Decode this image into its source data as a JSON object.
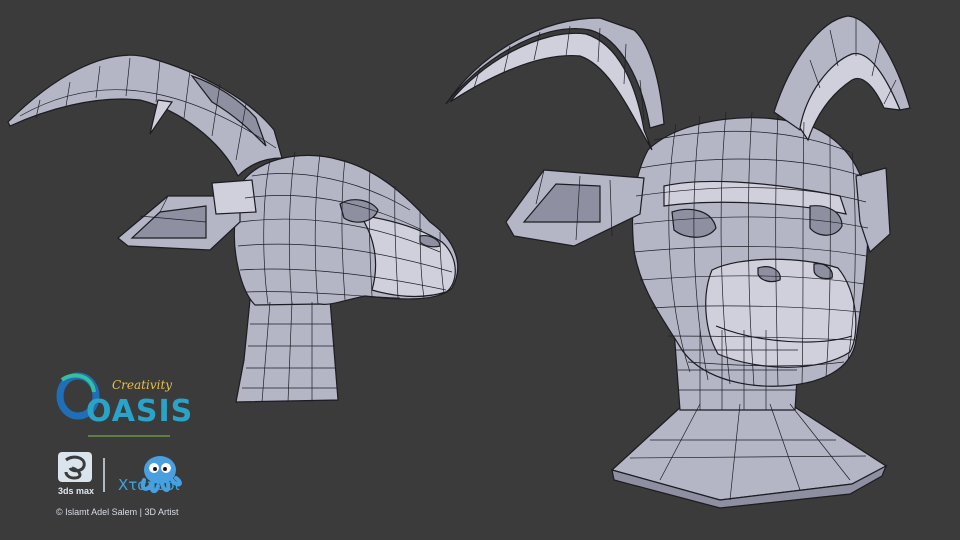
{
  "branding": {
    "tagline": "Creativity",
    "brand": "OASIS",
    "software": "3ds max",
    "studio": "Xταπόδι",
    "credit": "© Islamt Adel Salem | 3D Artist"
  },
  "colors": {
    "background": "#3b3b3b",
    "mesh": "#b4b6c6",
    "wire": "#1e1e26",
    "brand_blue": "#2aa3c8",
    "brand_gold": "#e6c04a"
  },
  "icons": [
    "3ds-max-logo-icon",
    "octopus-mascot-icon",
    "oasis-logo-icon"
  ]
}
